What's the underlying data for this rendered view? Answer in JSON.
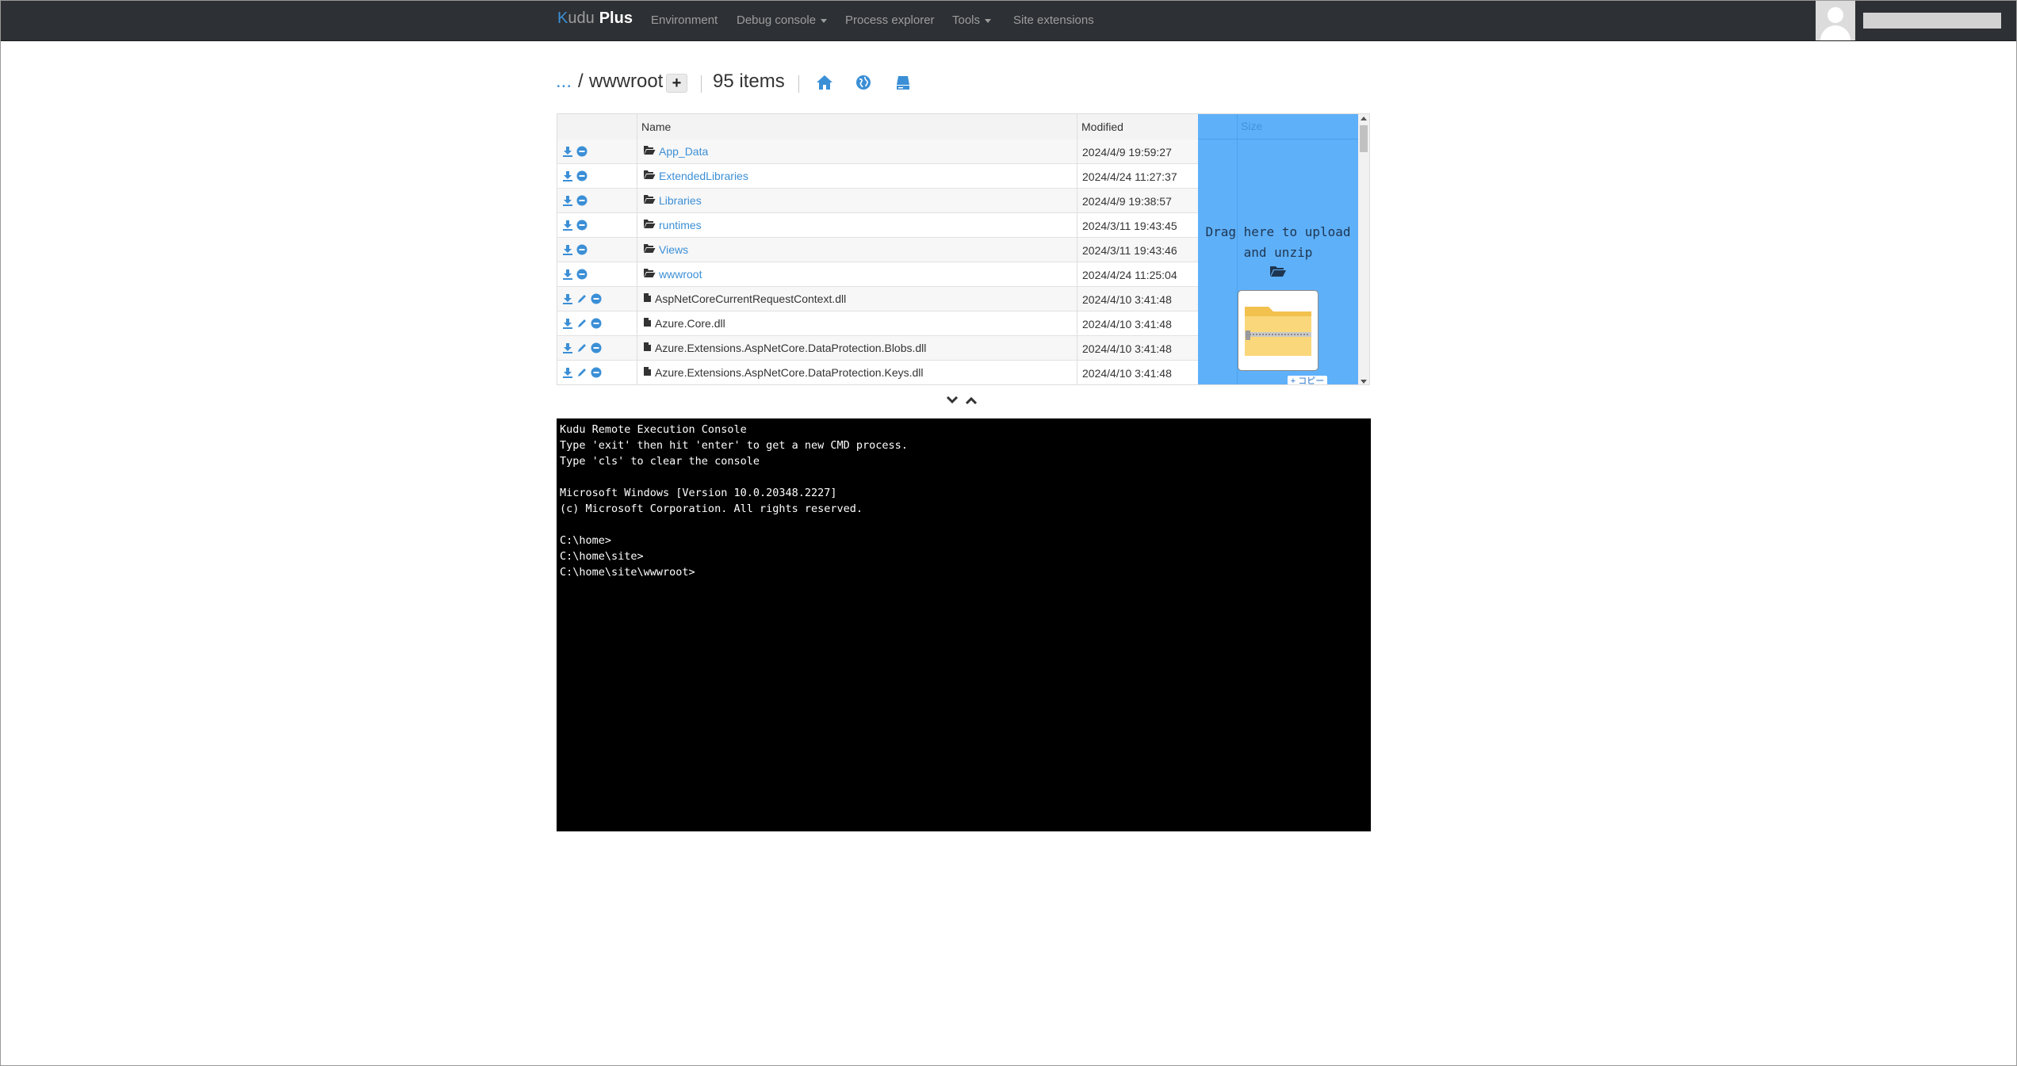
{
  "navbar": {
    "brand_k": "K",
    "brand_udu": "udu",
    "brand_plus": "Plus",
    "items": [
      {
        "label": "Environment",
        "dropdown": false
      },
      {
        "label": "Debug console",
        "dropdown": true
      },
      {
        "label": "Process explorer",
        "dropdown": false
      },
      {
        "label": "Tools",
        "dropdown": true
      },
      {
        "label": "Site extensions",
        "dropdown": false
      }
    ]
  },
  "breadcrumb": {
    "parent": "...",
    "separator": "/",
    "current": "wwwroot",
    "add_label": "+",
    "item_count": "95 items"
  },
  "table": {
    "headers": {
      "name": "Name",
      "modified": "Modified",
      "size": "Size"
    },
    "rows": [
      {
        "name": "App_Data",
        "type": "folder",
        "modified": "2024/4/9 19:59:27"
      },
      {
        "name": "ExtendedLibraries",
        "type": "folder",
        "modified": "2024/4/24 11:27:37"
      },
      {
        "name": "Libraries",
        "type": "folder",
        "modified": "2024/4/9 19:38:57"
      },
      {
        "name": "runtimes",
        "type": "folder",
        "modified": "2024/3/11 19:43:45"
      },
      {
        "name": "Views",
        "type": "folder",
        "modified": "2024/3/11 19:43:46"
      },
      {
        "name": "wwwroot",
        "type": "folder",
        "modified": "2024/4/24 11:25:04"
      },
      {
        "name": "AspNetCoreCurrentRequestContext.dll",
        "type": "file",
        "modified": "2024/4/10 3:41:48"
      },
      {
        "name": "Azure.Core.dll",
        "type": "file",
        "modified": "2024/4/10 3:41:48"
      },
      {
        "name": "Azure.Extensions.AspNetCore.DataProtection.Blobs.dll",
        "type": "file",
        "modified": "2024/4/10 3:41:48"
      },
      {
        "name": "Azure.Extensions.AspNetCore.DataProtection.Keys.dll",
        "type": "file",
        "modified": "2024/4/10 3:41:48"
      }
    ]
  },
  "dropzone": {
    "line1": "Drag here to upload",
    "line2": "and unzip",
    "copy_badge": "+ コピー"
  },
  "console": {
    "lines": [
      "Kudu Remote Execution Console",
      "Type 'exit' then hit 'enter' to get a new CMD process.",
      "Type 'cls' to clear the console",
      "",
      "Microsoft Windows [Version 10.0.20348.2227]",
      "(c) Microsoft Corporation. All rights reserved.",
      "",
      "C:\\home>",
      "C:\\home\\site>",
      "C:\\home\\site\\wwwroot>"
    ]
  },
  "colors": {
    "navbar_bg": "#2d3034",
    "link": "#3b8fd6",
    "dropzone_bg": "#5eb0f9",
    "console_bg": "#000000"
  }
}
